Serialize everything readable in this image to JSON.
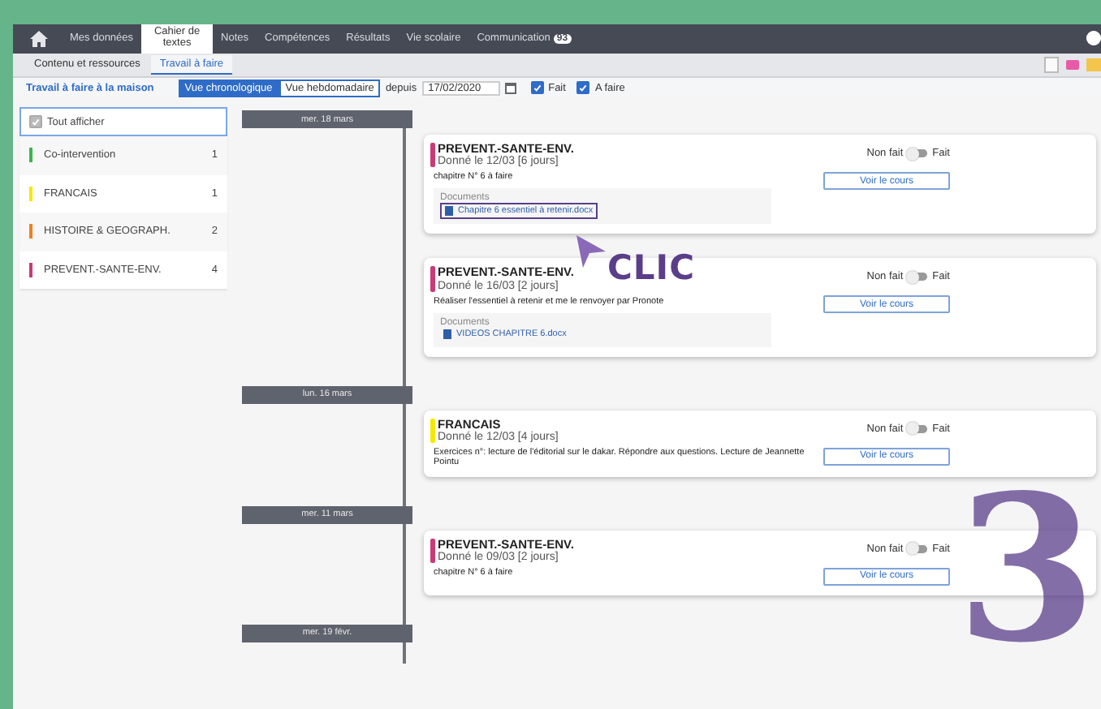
{
  "nav": {
    "items": [
      {
        "label": "Mes données",
        "selected": false
      },
      {
        "label": "Cahier de textes",
        "selected": true
      },
      {
        "label": "Notes",
        "selected": false
      },
      {
        "label": "Compétences",
        "selected": false
      },
      {
        "label": "Résultats",
        "selected": false
      },
      {
        "label": "Vie scolaire",
        "selected": false
      },
      {
        "label": "Communication",
        "selected": false,
        "badge": "93"
      }
    ]
  },
  "subtabs": [
    {
      "label": "Contenu et ressources",
      "selected": false
    },
    {
      "label": "Travail à faire",
      "selected": true
    }
  ],
  "toolbar": {
    "title": "Travail à faire à la maison",
    "views": [
      {
        "label": "Vue chronologique",
        "selected": true
      },
      {
        "label": "Vue hebdomadaire",
        "selected": false
      }
    ],
    "since_label": "depuis",
    "since_value": "17/02/2020",
    "filters": [
      {
        "label": "Fait",
        "checked": true
      },
      {
        "label": "A faire",
        "checked": true
      }
    ]
  },
  "sidebar": {
    "show_all": {
      "label": "Tout afficher",
      "checked": true
    },
    "subjects": [
      {
        "name": "Co-intervention",
        "count": "1",
        "color": "#3bb54a"
      },
      {
        "name": "FRANCAIS",
        "count": "1",
        "color": "#f5e800"
      },
      {
        "name": "HISTOIRE & GEOGRAPH.",
        "count": "2",
        "color": "#f07f1e"
      },
      {
        "name": "PREVENT.-SANTE-ENV.",
        "count": "4",
        "color": "#c93a78"
      }
    ]
  },
  "timeline": [
    {
      "date": "mer. 18 mars",
      "cards": [
        {
          "subject": "PREVENT.-SANTE-ENV.",
          "color": "#c93a78",
          "given": "Donné le 12/03 [6 jours]",
          "description": "chapitre N° 6 à faire",
          "documents": {
            "label": "Documents",
            "items": [
              {
                "name": "Chapitre 6 essentiel à retenir.docx",
                "highlighted": true
              }
            ]
          },
          "not_done": "Non fait",
          "done": "Fait",
          "on": false,
          "button": "Voir le cours"
        },
        {
          "subject": "PREVENT.-SANTE-ENV.",
          "color": "#c93a78",
          "given": "Donné le 16/03 [2 jours]",
          "description": "Réaliser l'essentiel à retenir et me le renvoyer par Pronote",
          "documents": {
            "label": "Documents",
            "items": [
              {
                "name": "VIDEOS CHAPITRE 6.docx",
                "highlighted": false
              }
            ]
          },
          "not_done": "Non fait",
          "done": "Fait",
          "on": false,
          "button": "Voir le cours"
        }
      ]
    },
    {
      "date": "lun. 16 mars",
      "cards": [
        {
          "subject": "FRANCAIS",
          "color": "#f5e800",
          "given": "Donné le 12/03 [4 jours]",
          "description": "Exercices n°: lecture de l'éditorial sur le dakar. Répondre aux questions. Lecture de Jeannette Pointu",
          "not_done": "Non fait",
          "done": "Fait",
          "on": false,
          "button": "Voir le cours"
        }
      ]
    },
    {
      "date": "mer. 11 mars",
      "cards": [
        {
          "subject": "PREVENT.-SANTE-ENV.",
          "color": "#c93a78",
          "given": "Donné le 09/03 [2 jours]",
          "description": "chapitre N° 6 à faire",
          "not_done": "Non fait",
          "done": "Fait",
          "on": false,
          "button": "Voir le cours"
        }
      ]
    },
    {
      "date": "mer. 19 févr."
    }
  ],
  "annotations": {
    "callout": "CLIC",
    "step": "3"
  }
}
